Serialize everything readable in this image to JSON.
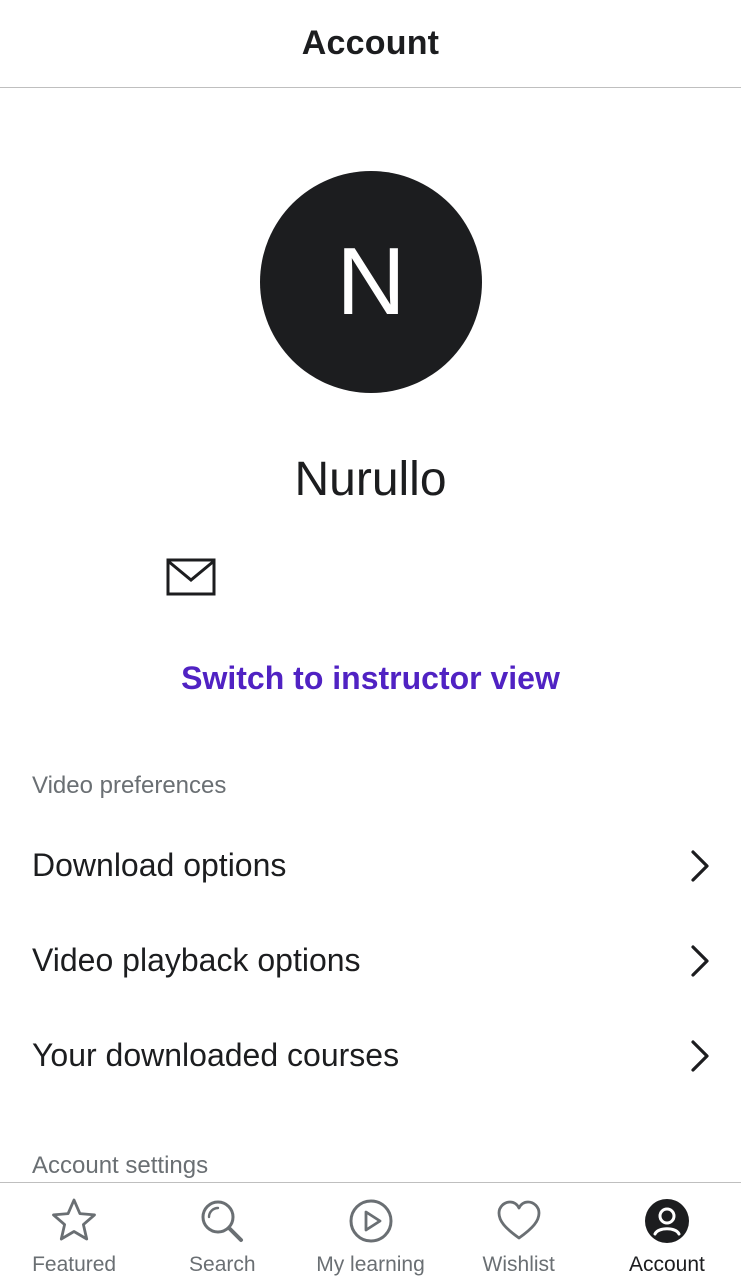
{
  "header": {
    "title": "Account"
  },
  "profile": {
    "avatar_initial": "N",
    "name": "Nurullo",
    "email": ""
  },
  "instructor_link": "Switch to instructor view",
  "sections": {
    "video_preferences": {
      "label": "Video preferences",
      "items": [
        {
          "label": "Download options"
        },
        {
          "label": "Video playback options"
        },
        {
          "label": "Your downloaded courses"
        }
      ]
    },
    "account_settings": {
      "label": "Account settings"
    }
  },
  "tabbar": {
    "tabs": [
      {
        "label": "Featured",
        "icon": "star-icon",
        "active": false
      },
      {
        "label": "Search",
        "icon": "search-icon",
        "active": false
      },
      {
        "label": "My learning",
        "icon": "play-circle-icon",
        "active": false
      },
      {
        "label": "Wishlist",
        "icon": "heart-icon",
        "active": false
      },
      {
        "label": "Account",
        "icon": "user-circle-icon",
        "active": true
      }
    ]
  },
  "colors": {
    "text": "#1c1d1f",
    "muted": "#6a6f73",
    "accent": "#5022c3",
    "avatar_bg": "#1c1d1f",
    "divider": "#bfbfbf"
  }
}
